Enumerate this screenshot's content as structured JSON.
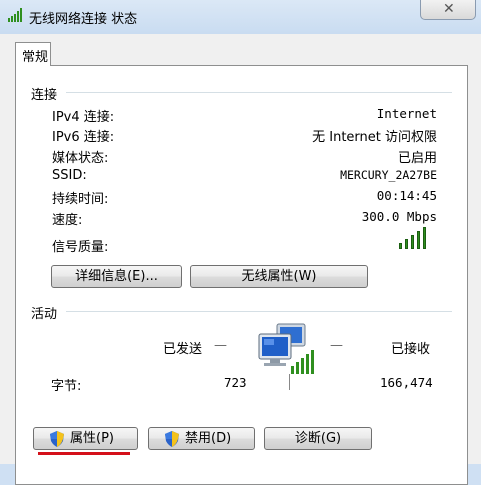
{
  "window": {
    "title": "无线网络连接 状态",
    "close_glyph": "✕"
  },
  "tabs": [
    {
      "label": "常规"
    }
  ],
  "connection": {
    "group_title": "连接",
    "rows": [
      {
        "label": "IPv4 连接:",
        "value": "Internet"
      },
      {
        "label": "IPv6 连接:",
        "value": "无 Internet 访问权限"
      },
      {
        "label": "媒体状态:",
        "value": "已启用"
      },
      {
        "label": "SSID:",
        "value": "MERCURY_2A27BE"
      },
      {
        "label": "持续时间:",
        "value": "00:14:45"
      },
      {
        "label": "速度:",
        "value": "300.0 Mbps"
      }
    ],
    "signal_label": "信号质量:",
    "signal_bars": 5,
    "signal_bars_max": 5,
    "details_button": "详细信息(E)...",
    "wireless_props_button": "无线属性(W)"
  },
  "activity": {
    "group_title": "活动",
    "sent_label": "已发送",
    "received_label": "已接收",
    "dash": "—",
    "bytes_label": "字节:",
    "bytes_sent": "723",
    "bytes_received": "166,474",
    "network_icon": "network-computers-icon"
  },
  "buttons": {
    "properties": "属性(P)",
    "disable": "禁用(D)",
    "diagnose": "诊断(G)"
  },
  "colors": {
    "signal_green": "#2f8f1f",
    "highlight_red": "#d4101a"
  }
}
